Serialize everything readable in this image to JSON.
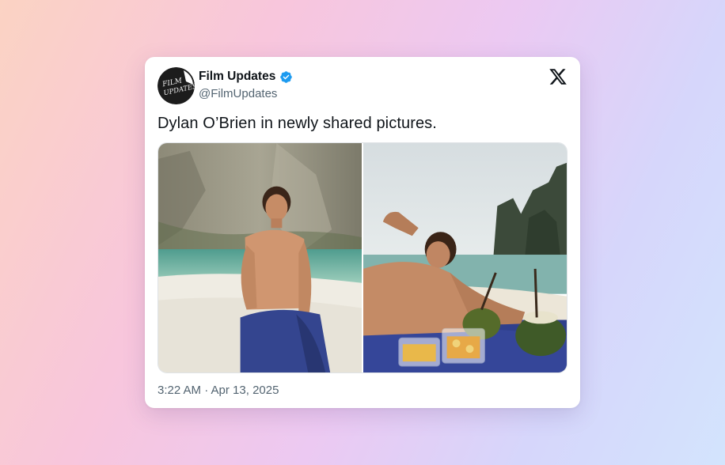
{
  "author": {
    "display_name": "Film Updates",
    "handle": "@FilmUpdates",
    "verified": true,
    "avatar_text": "FILM UPDATES",
    "avatar_icon": "film-updates-logo"
  },
  "tweet": {
    "text": "Dylan O’Brien in newly shared pictures.",
    "timestamp": "3:22 AM · Apr 13, 2025"
  },
  "media": [
    {
      "description_icon": "beach-cliff-photo"
    },
    {
      "description_icon": "beach-picnic-photo"
    }
  ],
  "colors": {
    "verified_blue": "#1d9bf0",
    "text_primary": "#0f1419",
    "text_secondary": "#536471",
    "card_bg": "#ffffff"
  }
}
